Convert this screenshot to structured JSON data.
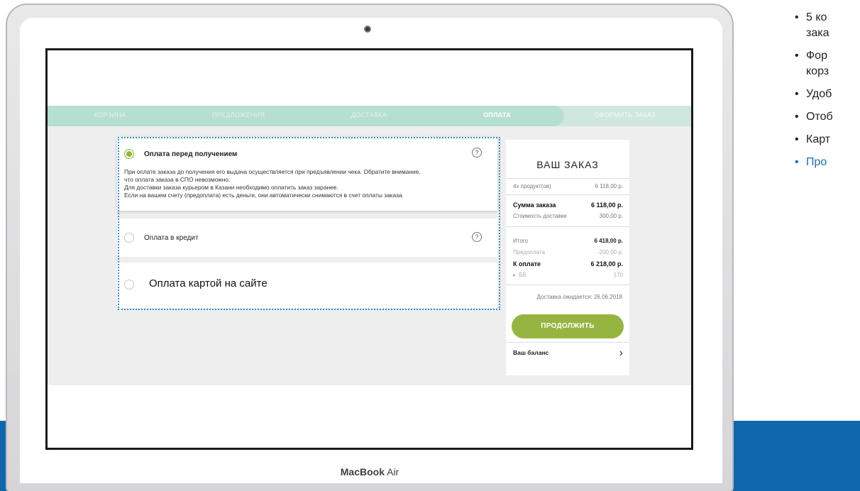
{
  "laptop": {
    "brand_bold": "MacBook",
    "brand_rest": "Air"
  },
  "steps": [
    {
      "label": "КОРЗИНА",
      "state": "done"
    },
    {
      "label": "ПРЕДЛОЖЕНИЯ",
      "state": "done"
    },
    {
      "label": "ДОСТАВКА",
      "state": "done"
    },
    {
      "label": "ОПЛАТА",
      "state": "active"
    },
    {
      "label": "ОФОРМИТЬ ЗАКАЗ",
      "state": "pending"
    }
  ],
  "payment": {
    "options": [
      {
        "title": "Оплата перед получением",
        "selected": true,
        "description": [
          "При оплате заказа до получения его выдача осуществляется при предъявлении чека. Обратите внимание,",
          "что оплата заказа в СПО невозможно.",
          "Для доставки заказа курьером в Казани необходимо оплатить заказ заранее.",
          "Если на вашем счету (предоплата) есть деньги, они автоматически снимаются в счет оплаты заказа."
        ]
      },
      {
        "title": "Оплата в кредит",
        "selected": false
      },
      {
        "title": "Оплата картой на сайте",
        "selected": false
      }
    ],
    "help_glyph": "?"
  },
  "summary": {
    "title": "ВАШ ЗАКАЗ",
    "rows": [
      {
        "label": "4х продукт(ов)",
        "value": "6 118,00 р."
      },
      {
        "label": "Сумма заказа",
        "value": "6 118,00 р."
      },
      {
        "label": "Стоимость доставки",
        "value": "300,00 р."
      },
      {
        "label": "Итого",
        "value": "6 418,00 р."
      },
      {
        "label": "Предоплата",
        "value": "-200,00 р."
      },
      {
        "label": "К оплате",
        "value": "6 218,00 р."
      },
      {
        "label": "ББ",
        "value": "170"
      }
    ],
    "delivery_note": "Доставка ожидается: 26.06.2018",
    "continue_label": "ПРОДОЛЖИТЬ",
    "balance_label": "Ваш баланс"
  },
  "bullets": [
    {
      "text": "5 ко",
      "accent": false
    },
    {
      "text": "зака",
      "accent": false,
      "continuation": true
    },
    {
      "text": "Фор",
      "accent": false
    },
    {
      "text": "корз",
      "accent": false,
      "continuation": true
    },
    {
      "text": "Удоб",
      "accent": false
    },
    {
      "text": "Отоб",
      "accent": false
    },
    {
      "text": "Карт",
      "accent": false
    },
    {
      "text": "Про",
      "accent": true
    }
  ],
  "colors": {
    "accent_green": "#96b540",
    "steps_bar": "#b5dfd1",
    "focus_outline": "#2f8fcf",
    "blue_band": "#1167ac",
    "bullet_accent": "#1a6db6"
  },
  "icons": {
    "radio": "radio-icon",
    "help": "help-circle-icon",
    "chevron": "chevron-right-icon",
    "expand": "triangle-right-icon"
  }
}
